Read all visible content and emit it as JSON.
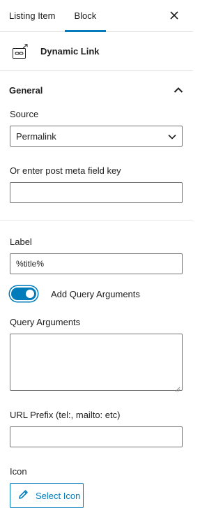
{
  "tabs": [
    "Listing Item",
    "Block"
  ],
  "active_tab": "Block",
  "close_icon": "close-icon",
  "block": {
    "title": "Dynamic Link",
    "icon": "dynamic-link-icon"
  },
  "panel": {
    "title": "General",
    "expanded": true
  },
  "source": {
    "label": "Source",
    "value": "Permalink"
  },
  "meta_key": {
    "label": "Or enter post meta field key",
    "value": ""
  },
  "link_label": {
    "label": "Label",
    "value": "%title%"
  },
  "query_toggle": {
    "label": "Add Query Arguments",
    "checked": true
  },
  "query_args": {
    "label": "Query Arguments",
    "value": ""
  },
  "url_prefix": {
    "label": "URL Prefix (tel:, mailto: etc)",
    "value": ""
  },
  "icon_field": {
    "label": "Icon",
    "button_label": "Select Icon"
  },
  "colors": {
    "accent": "#007cba",
    "text": "#1e1e1e",
    "border": "#757575"
  }
}
